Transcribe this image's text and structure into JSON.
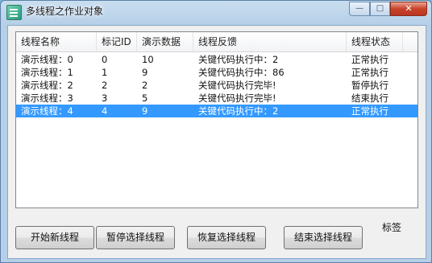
{
  "window": {
    "title": "多线程之作业对象",
    "controls": {
      "minimize": "—",
      "maximize": "□",
      "close": "✕"
    }
  },
  "list": {
    "columns": [
      "线程名称",
      "标记ID",
      "演示数据",
      "线程反馈",
      "线程状态"
    ],
    "rows": [
      [
        "演示线程：0",
        "0",
        "10",
        "关键代码执行中：2",
        "正常执行"
      ],
      [
        "演示线程：1",
        "1",
        "9",
        "关键代码执行中：86",
        "正常执行"
      ],
      [
        "演示线程：2",
        "2",
        "2",
        "关键代码执行完毕!",
        "暂停执行"
      ],
      [
        "演示线程：3",
        "3",
        "5",
        "关键代码执行完毕!",
        "结束执行"
      ],
      [
        "演示线程：4",
        "4",
        "9",
        "关键代码执行中：2",
        "正常执行"
      ]
    ],
    "selected_row": 4
  },
  "buttons": {
    "start": "开始新线程",
    "pause": "暂停选择线程",
    "resume": "恢复选择线程",
    "end": "结束选择线程"
  },
  "label": "标签",
  "colors": {
    "selection": "#3399ff",
    "close_button": "#c8432b"
  }
}
